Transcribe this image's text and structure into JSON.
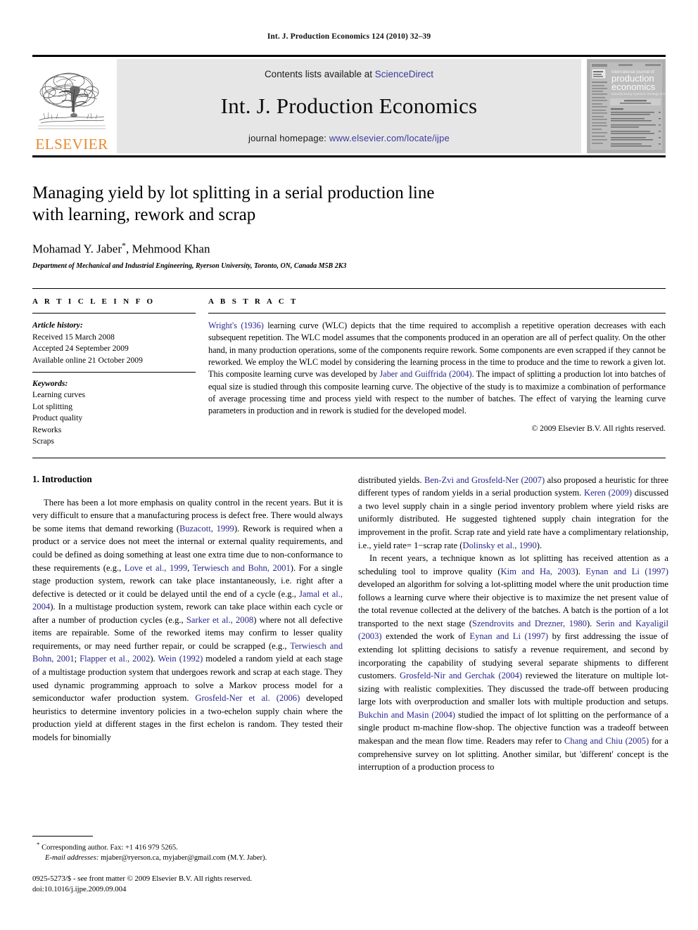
{
  "running_head": "Int. J. Production Economics 124 (2010) 32–39",
  "masthead": {
    "contents_prefix": "Contents lists available at ",
    "sciencedirect": "ScienceDirect",
    "journal_title": "Int. J. Production Economics",
    "homepage_prefix": "journal homepage: ",
    "homepage_url": "www.elsevier.com/locate/ijpe",
    "publisher_wordmark": "ELSEVIER",
    "cover": {
      "line1": "international journal of",
      "line2": "production",
      "line3": "economics",
      "line4": "Manufacturing Systems, Strategy & Design"
    },
    "colors": {
      "elsevier_orange": "#E8892B",
      "link_blue": "#3B3B9E",
      "band_gray": "#e6e6e6"
    }
  },
  "article": {
    "title_line1": "Managing yield by lot splitting in a serial production line",
    "title_line2": "with learning, rework and scrap",
    "authors": "Mohamad Y. Jaber",
    "author_marker": "*",
    "authors_rest": ", Mehmood Khan",
    "affiliation": "Department of Mechanical and Industrial Engineering, Ryerson University, Toronto, ON, Canada M5B 2K3"
  },
  "article_info": {
    "label": "A R T I C L E   I N F O",
    "history_heading": "Article history:",
    "history": [
      "Received 15 March 2008",
      "Accepted 24 September 2009",
      "Available online 21 October 2009"
    ],
    "keywords_heading": "Keywords:",
    "keywords": [
      "Learning curves",
      "Lot splitting",
      "Product quality",
      "Reworks",
      "Scraps"
    ]
  },
  "abstract": {
    "label": "A B S T R A C T",
    "ref1": "Wright's (1936)",
    "text1": " learning curve (WLC) depicts that the time required to accomplish a repetitive operation decreases with each subsequent repetition. The WLC model assumes that the components produced in an operation are all of perfect quality. On the other hand, in many production operations, some of the components require rework. Some components are even scrapped if they cannot be reworked. We employ the WLC model by considering the learning process in the time to produce and the time to rework a given lot. This composite learning curve was developed by ",
    "ref2": "Jaber and Guiffrida (2004)",
    "text2": ". The impact of splitting a production lot into batches of equal size is studied through this composite learning curve. The objective of the study is to maximize a combination of performance of average processing time and process yield with respect to the number of batches. The effect of varying the learning curve parameters in production and in rework is studied for the developed model.",
    "copyright": "© 2009 Elsevier B.V. All rights reserved."
  },
  "body": {
    "section_heading": "1.  Introduction",
    "left_paragraph_1_a": "There has been a lot more emphasis on quality control in the recent years. But it is very difficult to ensure that a manufacturing process is defect free. There would always be some items that demand reworking (",
    "left_ref_1": "Buzacott, 1999",
    "left_paragraph_1_b": "). Rework is required when a product or a service does not meet the internal or external quality requirements, and could be defined as doing something at least one extra time due to non-conformance to these requirements (e.g., ",
    "left_ref_2": "Love et al., 1999",
    "left_paragraph_1_c": ", ",
    "left_ref_3": "Terwiesch and Bohn, 2001",
    "left_paragraph_1_d": "). For a single stage production system, rework can take place instantaneously, i.e. right after a defective is detected or it could be delayed until the end of a cycle (e.g., ",
    "left_ref_4": "Jamal et al., 2004",
    "left_paragraph_1_e": "). In a multistage production system, rework can take place within each cycle or after a number of production cycles (e.g., ",
    "left_ref_5": "Sarker et al., 2008",
    "left_paragraph_1_f": ") where not all defective items are repairable. Some of the reworked items may confirm to lesser quality requirements, or may need further repair, or could be scrapped (e.g., ",
    "left_ref_6": "Terwiesch and Bohn, 2001",
    "left_paragraph_1_g": "; ",
    "left_ref_7": "Flapper et al., 2002",
    "left_paragraph_1_h": "). ",
    "left_ref_8": "Wein (1992)",
    "left_paragraph_1_i": " modeled a random yield at each stage of a multistage production system that undergoes rework and scrap at each stage. They used dynamic programming approach to solve a Markov process model for a semiconductor wafer production system. ",
    "left_ref_9": "Grosfeld-Ner et al. (2006)",
    "left_paragraph_1_j": " developed heuristics to determine inventory policies in a two-echelon supply chain where the production yield at different stages in the first echelon is random. They tested their models for binomially",
    "right_paragraph_1_a": "distributed yields. ",
    "right_ref_1": "Ben-Zvi and Grosfeld-Ner (2007)",
    "right_paragraph_1_b": " also proposed a heuristic for three different types of random yields in a serial production system. ",
    "right_ref_2": "Keren (2009)",
    "right_paragraph_1_c": " discussed a two level supply chain in a single period inventory problem where yield risks are uniformly distributed. He suggested tightened supply chain integration for the improvement in the profit. Scrap rate and yield rate have a complimentary relationship, i.e., yield rate= 1−scrap rate (",
    "right_ref_3": "Dolinsky et al., 1990",
    "right_paragraph_1_d": ").",
    "right_paragraph_2_a": "In recent years, a technique known as lot splitting has received attention as a scheduling tool to improve quality (",
    "right_ref_4": "Kim and Ha, 2003",
    "right_paragraph_2_b": "). ",
    "right_ref_5": "Eynan and Li (1997)",
    "right_paragraph_2_c": " developed an algorithm for solving a lot-splitting model where the unit production time follows a learning curve where their objective is to maximize the net present value of the total revenue collected at the delivery of the batches. A batch is the portion of a lot transported to the next stage (",
    "right_ref_6": "Szendrovits and Drezner, 1980",
    "right_paragraph_2_d": "). ",
    "right_ref_7": "Serin and Kayaligil (2003)",
    "right_paragraph_2_e": " extended the work of ",
    "right_ref_8": "Eynan and Li (1997)",
    "right_paragraph_2_f": " by first addressing the issue of extending lot splitting decisions to satisfy a revenue requirement, and second by incorporating the capability of studying several separate shipments to different customers. ",
    "right_ref_9": "Grosfeld-Nir and Gerchak (2004)",
    "right_paragraph_2_g": " reviewed the literature on multiple lot-sizing with realistic complexities. They discussed the trade-off between producing large lots with overproduction and smaller lots with multiple production and setups. ",
    "right_ref_10": "Bukchin and Masin (2004)",
    "right_paragraph_2_h": " studied the impact of lot splitting on the performance of a single product m-machine flow-shop. The objective function was a tradeoff between makespan and the mean flow time. Readers may refer to ",
    "right_ref_11": "Chang and Chiu (2005)",
    "right_paragraph_2_i": " for a comprehensive survey on lot splitting. Another similar, but 'different' concept is the interruption of a production process to"
  },
  "footnote": {
    "marker": "*",
    "corresponding": "Corresponding author. Fax: +1 416 979 5265.",
    "email_label": "E-mail addresses:",
    "emails": "mjaber@ryerson.ca, myjaber@gmail.com (M.Y. Jaber)."
  },
  "imprint": {
    "issn_line": "0925-5273/$ - see front matter © 2009 Elsevier B.V. All rights reserved.",
    "doi_line": "doi:10.1016/j.ijpe.2009.09.004"
  }
}
